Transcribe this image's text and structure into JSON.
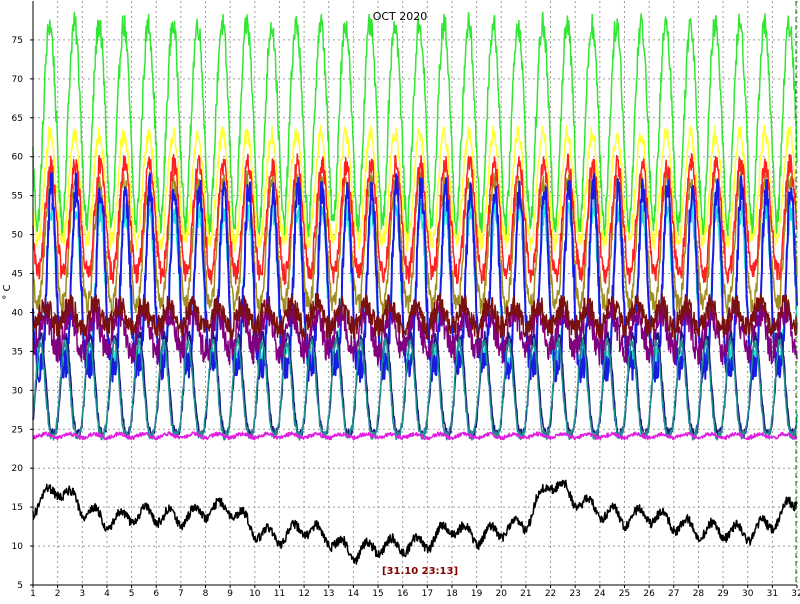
{
  "chart_data": {
    "type": "line",
    "title": "OCT 2020",
    "ylabel": "° C",
    "xlabel": "",
    "xlim": [
      1,
      32
    ],
    "ylim": [
      5,
      80
    ],
    "x_ticks": [
      "1",
      "2",
      "3",
      "4",
      "5",
      "6",
      "7",
      "8",
      "9",
      "10",
      "11",
      "12",
      "13",
      "14",
      "15",
      "16",
      "17",
      "18",
      "19",
      "20",
      "21",
      "22",
      "23",
      "24",
      "25",
      "26",
      "27",
      "28",
      "29",
      "30",
      "31",
      "32"
    ],
    "y_ticks": [
      "5",
      "10",
      "15",
      "20",
      "25",
      "30",
      "35",
      "40",
      "45",
      "50",
      "55",
      "60",
      "65",
      "70",
      "75"
    ],
    "grid": true,
    "cursor_label": "[31.10 23:13]",
    "colors": {
      "background": "#ffffff",
      "grid": "#9a9a9a",
      "axis": "#000000",
      "title": "#000000",
      "tick_text": "#000000",
      "cursor_text": "#800000",
      "cursor_line": "#008000"
    },
    "series": [
      {
        "color": "#33e633",
        "base": 51,
        "amp": 26,
        "peak": 0.68,
        "sharp": 0.8,
        "noise": 1.6,
        "width": 1.5
      },
      {
        "color": "#ffff33",
        "base": 49,
        "amp": 14,
        "peak": 0.69,
        "sharp": 1.0,
        "noise": 1.2,
        "width": 1.5
      },
      {
        "color": "#a08c20",
        "base": 41,
        "amp": 16,
        "peak": 0.7,
        "sharp": 1.2,
        "noise": 1.3,
        "width": 1.5
      },
      {
        "color": "#ff2020",
        "base": 45,
        "amp": 14,
        "peak": 0.72,
        "sharp": 1.1,
        "noise": 1.4,
        "width": 1.5
      },
      {
        "color": "#20e0e0",
        "base": 34,
        "amp": 19,
        "peak": 0.74,
        "sharp": 1.6,
        "noise": 1.5,
        "width": 1.5
      },
      {
        "color": "#1a1ae6",
        "base": 33,
        "amp": 23,
        "peak": 0.75,
        "sharp": 1.7,
        "noise": 2.0,
        "width": 2.0
      },
      {
        "color": "#800080",
        "base": 35,
        "amp": 5,
        "peak": 0.5,
        "sharp": 1.0,
        "noise": 1.8,
        "width": 1.5
      },
      {
        "color": "#7a1010",
        "base": 38,
        "amp": 3,
        "peak": 0.5,
        "sharp": 1.0,
        "noise": 1.5,
        "width": 1.5
      },
      {
        "color": "#1a1a80",
        "base": 24.5,
        "amp": 12.5,
        "peak": 0.33,
        "sharp": 1.5,
        "noise": 0.6,
        "width": 1.5
      },
      {
        "color": "#1f8f8f",
        "base": 24.2,
        "amp": 12.0,
        "peak": 0.3,
        "sharp": 1.5,
        "noise": 0.6,
        "width": 1.5
      },
      {
        "color": "#e020e0",
        "base": 23.9,
        "amp": 0.5,
        "peak": 0.5,
        "sharp": 1.0,
        "noise": 0.25,
        "width": 1.5
      },
      {
        "color": "#000000",
        "base": 12.5,
        "amp": 2.0,
        "peak": 0.55,
        "sharp": 1.0,
        "noise": 0.6,
        "width": 1.5,
        "daily_levels": [
          15,
          17.5,
          15,
          13,
          14,
          14,
          13.5,
          14.5,
          15,
          12,
          11,
          12.5,
          11,
          9,
          10,
          10,
          10.5,
          12.5,
          11,
          12,
          13,
          18.5,
          16,
          14.5,
          13.5,
          14,
          13,
          12,
          12,
          11.5,
          13,
          16
        ]
      }
    ]
  }
}
